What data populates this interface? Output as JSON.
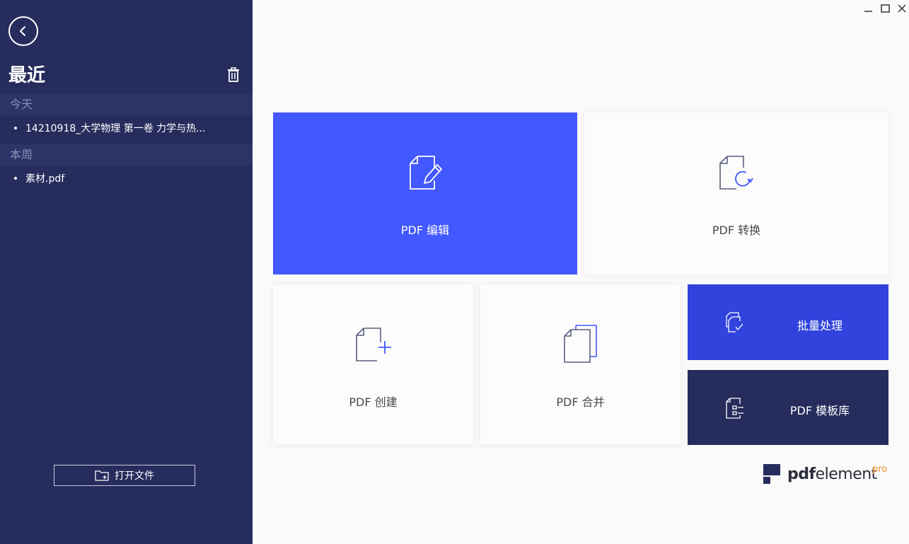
{
  "window": {
    "minimize_icon": "minimize-icon",
    "maximize_icon": "maximize-icon",
    "close_icon": "close-icon"
  },
  "sidebar": {
    "title": "最近",
    "back_icon": "chevron-left-icon",
    "trash_icon": "trash-icon",
    "sections": [
      {
        "header": "今天",
        "files": [
          "14210918_大学物理  第一卷  力学与热..."
        ]
      },
      {
        "header": "本周",
        "files": [
          "素材.pdf"
        ]
      }
    ],
    "open_file_label": "打开文件",
    "open_file_icon": "folder-add-icon"
  },
  "tiles": {
    "edit": {
      "label": "PDF 编辑",
      "icon": "edit-document-icon",
      "color": "#4358ff"
    },
    "convert": {
      "label": "PDF 转换",
      "icon": "convert-document-icon"
    },
    "create": {
      "label": "PDF 创建",
      "icon": "create-document-icon"
    },
    "merge": {
      "label": "PDF 合并",
      "icon": "merge-documents-icon"
    },
    "batch": {
      "label": "批量处理",
      "icon": "batch-process-icon",
      "color": "#3043dc"
    },
    "templates": {
      "label": "PDF 模板库",
      "icon": "template-library-icon",
      "color": "#262c5c"
    }
  },
  "brand": {
    "name_bold": "pdf",
    "name_regular": "element",
    "edition": "pro",
    "edition_color": "#f28b1e"
  }
}
